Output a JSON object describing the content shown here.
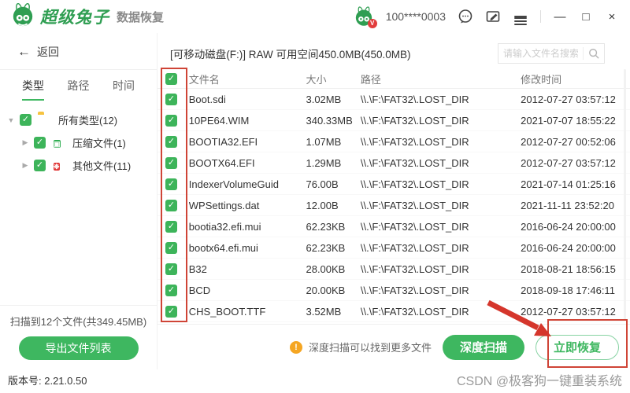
{
  "colors": {
    "brand_green": "#3eb760",
    "annotation_red": "#cf4436",
    "warning_orange": "#f5a623"
  },
  "icons": {
    "back": "←",
    "check": "✓",
    "caret_down": "▼",
    "caret_right": "▶",
    "minimize": "—",
    "maximize": "□",
    "close": "×",
    "warning": "!",
    "vip": "V"
  },
  "titlebar": {
    "app_name": "超级兔子",
    "app_subtitle": "数据恢复",
    "username": "100****0003"
  },
  "sidebar": {
    "back_label": "返回",
    "tabs": [
      {
        "label": "类型",
        "active": true
      },
      {
        "label": "路径",
        "active": false
      },
      {
        "label": "时间",
        "active": false
      }
    ],
    "tree": [
      {
        "label": "所有类型(12)",
        "icon": "folder-icon",
        "checked": true,
        "expanded": true
      },
      {
        "label": "压缩文件(1)",
        "icon": "archive-file-icon",
        "checked": true,
        "expanded": false
      },
      {
        "label": "其他文件(11)",
        "icon": "other-file-icon",
        "checked": true,
        "expanded": false
      }
    ],
    "scan_status": "扫描到12个文件(共349.45MB)",
    "export_button": "导出文件列表"
  },
  "main": {
    "drive_title": "[可移动磁盘(F:)] RAW 可用空间450.0MB(450.0MB)",
    "search_placeholder": "请输入文件名搜索",
    "columns": [
      "文件名",
      "大小",
      "路径",
      "修改时间"
    ],
    "rows": [
      {
        "checked": true,
        "name": "Boot.sdi",
        "size": "3.02MB",
        "path": "\\\\.\\F:\\FAT32\\.LOST_DIR",
        "mtime": "2012-07-27 03:57:12"
      },
      {
        "checked": true,
        "name": "10PE64.WIM",
        "size": "340.33MB",
        "path": "\\\\.\\F:\\FAT32\\.LOST_DIR",
        "mtime": "2021-07-07 18:55:22"
      },
      {
        "checked": true,
        "name": "BOOTIA32.EFI",
        "size": "1.07MB",
        "path": "\\\\.\\F:\\FAT32\\.LOST_DIR",
        "mtime": "2012-07-27 00:52:06"
      },
      {
        "checked": true,
        "name": "BOOTX64.EFI",
        "size": "1.29MB",
        "path": "\\\\.\\F:\\FAT32\\.LOST_DIR",
        "mtime": "2012-07-27 03:57:12"
      },
      {
        "checked": true,
        "name": "IndexerVolumeGuid",
        "size": "76.00B",
        "path": "\\\\.\\F:\\FAT32\\.LOST_DIR",
        "mtime": "2021-07-14 01:25:16"
      },
      {
        "checked": true,
        "name": "WPSettings.dat",
        "size": "12.00B",
        "path": "\\\\.\\F:\\FAT32\\.LOST_DIR",
        "mtime": "2021-11-11 23:52:20"
      },
      {
        "checked": true,
        "name": "bootia32.efi.mui",
        "size": "62.23KB",
        "path": "\\\\.\\F:\\FAT32\\.LOST_DIR",
        "mtime": "2016-06-24 20:00:00"
      },
      {
        "checked": true,
        "name": "bootx64.efi.mui",
        "size": "62.23KB",
        "path": "\\\\.\\F:\\FAT32\\.LOST_DIR",
        "mtime": "2016-06-24 20:00:00"
      },
      {
        "checked": true,
        "name": "B32",
        "size": "28.00KB",
        "path": "\\\\.\\F:\\FAT32\\.LOST_DIR",
        "mtime": "2018-08-21 18:56:15"
      },
      {
        "checked": true,
        "name": "BCD",
        "size": "20.00KB",
        "path": "\\\\.\\F:\\FAT32\\.LOST_DIR",
        "mtime": "2018-09-18 17:46:11"
      },
      {
        "checked": true,
        "name": "CHS_BOOT.TTF",
        "size": "3.52MB",
        "path": "\\\\.\\F:\\FAT32\\.LOST_DIR",
        "mtime": "2012-07-27 03:57:12"
      }
    ],
    "footer": {
      "hint": "深度扫描可以找到更多文件",
      "deep_scan_button": "深度扫描",
      "recover_button": "立即恢复"
    }
  },
  "statusbar": {
    "version": "版本号: 2.21.0.50",
    "watermark": "CSDN @极客狗一键重装系统"
  }
}
